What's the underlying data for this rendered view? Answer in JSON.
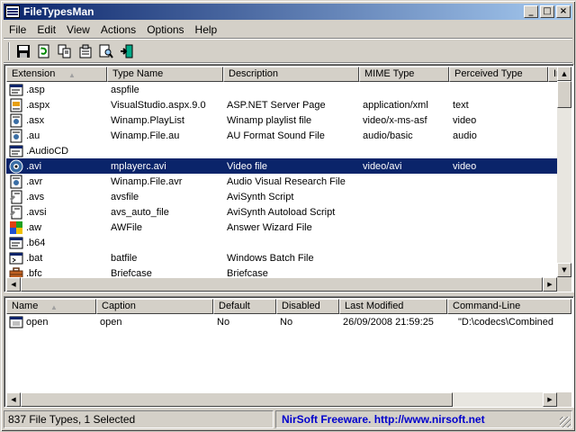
{
  "window": {
    "title": "FileTypesMan",
    "controls": {
      "minimize": "_",
      "maximize": "□",
      "close": "×"
    }
  },
  "menu": [
    "File",
    "Edit",
    "View",
    "Actions",
    "Options",
    "Help"
  ],
  "toolbar": {
    "buttons": [
      "save-icon",
      "refresh-icon",
      "copy-icon",
      "properties-icon",
      "find-icon",
      "exit-icon"
    ]
  },
  "filetypes": {
    "columns": [
      "Extension",
      "Type Name",
      "Description",
      "MIME Type",
      "Perceived Type",
      "In"
    ],
    "sort_column": "Extension",
    "rows": [
      {
        "icon": "generic-window-icon",
        "ext": ".asp",
        "type": "aspfile",
        "desc": "",
        "mime": "",
        "perceived": ""
      },
      {
        "icon": "aspx-file-icon",
        "ext": ".aspx",
        "type": "VisualStudio.aspx.9.0",
        "desc": "ASP.NET Server Page",
        "mime": "application/xml",
        "perceived": "text"
      },
      {
        "icon": "media-file-icon",
        "ext": ".asx",
        "type": "Winamp.PlayList",
        "desc": "Winamp playlist file",
        "mime": "video/x-ms-asf",
        "perceived": "video"
      },
      {
        "icon": "media-file-icon",
        "ext": ".au",
        "type": "Winamp.File.au",
        "desc": "AU Format Sound File",
        "mime": "audio/basic",
        "perceived": "audio"
      },
      {
        "icon": "generic-window-icon",
        "ext": ".AudioCD",
        "type": "",
        "desc": "",
        "mime": "",
        "perceived": ""
      },
      {
        "icon": "video-file-icon",
        "ext": ".avi",
        "type": "mplayerc.avi",
        "desc": "Video file",
        "mime": "video/avi",
        "perceived": "video",
        "selected": true
      },
      {
        "icon": "media-file-icon",
        "ext": ".avr",
        "type": "Winamp.File.avr",
        "desc": "Audio Visual Research File",
        "mime": "",
        "perceived": ""
      },
      {
        "icon": "script-file-icon",
        "ext": ".avs",
        "type": "avsfile",
        "desc": "AviSynth Script",
        "mime": "",
        "perceived": ""
      },
      {
        "icon": "script-file-icon",
        "ext": ".avsi",
        "type": "avs_auto_file",
        "desc": "AviSynth Autoload Script",
        "mime": "",
        "perceived": ""
      },
      {
        "icon": "wizard-file-icon",
        "ext": ".aw",
        "type": "AWFile",
        "desc": "Answer Wizard File",
        "mime": "",
        "perceived": ""
      },
      {
        "icon": "generic-window-icon",
        "ext": ".b64",
        "type": "",
        "desc": "",
        "mime": "",
        "perceived": ""
      },
      {
        "icon": "batch-file-icon",
        "ext": ".bat",
        "type": "batfile",
        "desc": "Windows Batch File",
        "mime": "",
        "perceived": ""
      },
      {
        "icon": "briefcase-icon",
        "ext": ".bfc",
        "type": "Briefcase",
        "desc": "Briefcase",
        "mime": "",
        "perceived": ""
      }
    ]
  },
  "actions": {
    "columns": [
      "Name",
      "Caption",
      "Default",
      "Disabled",
      "Last Modified",
      "Command-Line"
    ],
    "sort_column": "Name",
    "rows": [
      {
        "icon": "action-icon",
        "name": "open",
        "caption": "open",
        "default": "No",
        "disabled": "No",
        "modified": "26/09/2008 21:59:25",
        "command": "\"D:\\codecs\\Combined Comm"
      }
    ]
  },
  "status": {
    "count": "837 File Types, 1 Selected",
    "credit": "NirSoft Freeware.  http://www.nirsoft.net"
  },
  "colors": {
    "selection": "#0a246a",
    "titlebar": "#0a246a",
    "link": "#0000cc"
  }
}
